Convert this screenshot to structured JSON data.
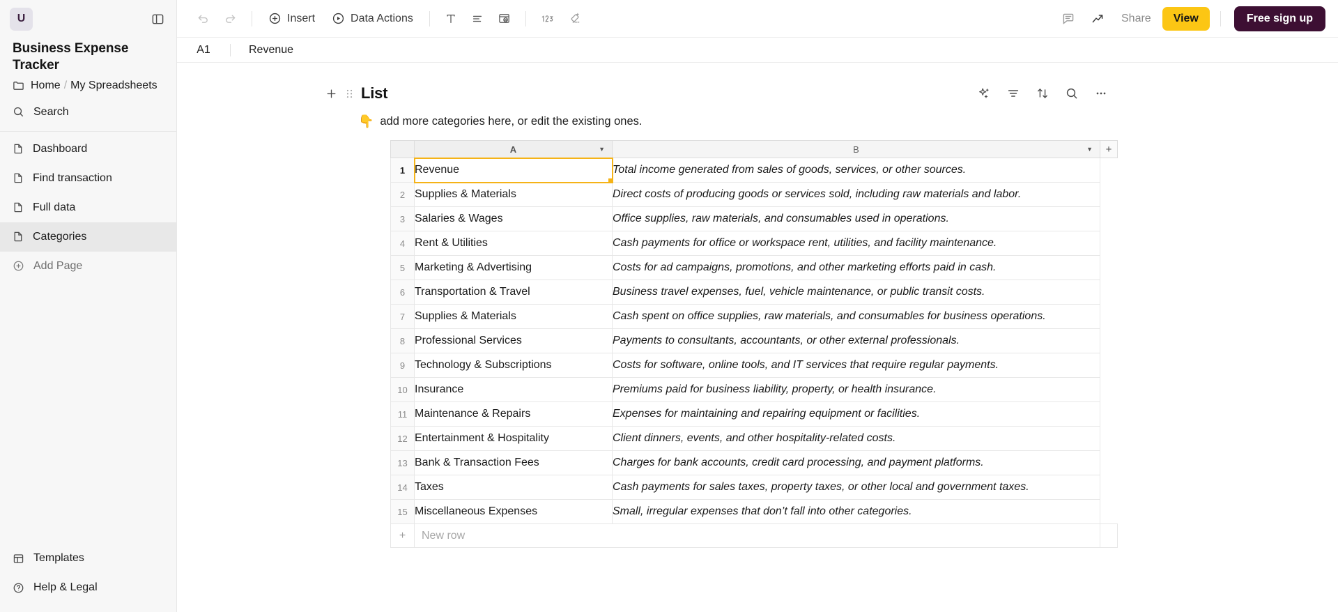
{
  "sidebar": {
    "avatar_initial": "U",
    "doc_title": "Business Expense Tracker",
    "breadcrumb": {
      "home": "Home",
      "separator": "/",
      "folder": "My Spreadsheets"
    },
    "search_label": "Search",
    "pages": [
      {
        "label": "Dashboard",
        "selected": false
      },
      {
        "label": "Find transaction",
        "selected": false
      },
      {
        "label": "Full data",
        "selected": false
      },
      {
        "label": "Categories",
        "selected": true
      }
    ],
    "add_page_label": "Add Page",
    "footer": [
      {
        "label": "Templates"
      },
      {
        "label": "Help & Legal"
      }
    ]
  },
  "toolbar": {
    "undo_label": "Undo",
    "redo_label": "Redo",
    "insert_label": "Insert",
    "data_actions_label": "Data Actions",
    "text_label": "Text",
    "align_label": "Align",
    "fill_label": "Fill color",
    "number_format_label": "123",
    "clear_format_label": "Clear formatting",
    "comment_label": "Comments",
    "insights_label": "Insights",
    "share_label": "Share",
    "view_label": "View",
    "signup_label": "Free sign up"
  },
  "formula_bar": {
    "cell_ref": "A1",
    "value": "Revenue"
  },
  "block": {
    "title": "List",
    "hint_emoji": "👇",
    "hint_text": "add more categories here, or edit the existing ones."
  },
  "grid": {
    "columns": [
      "A",
      "B"
    ],
    "add_column_label": "+",
    "selected_cell": "A1",
    "new_row_label": "New row",
    "new_row_plus": "+",
    "rows": [
      {
        "n": "1",
        "a": "Revenue",
        "b": "Total income generated from sales of goods, services, or other sources."
      },
      {
        "n": "2",
        "a": "Supplies & Materials",
        "b": "Direct costs of producing goods or services sold, including raw materials and labor."
      },
      {
        "n": "3",
        "a": "Salaries & Wages",
        "b": "Office supplies, raw materials, and consumables used in operations."
      },
      {
        "n": "4",
        "a": "Rent & Utilities",
        "b": "Cash payments for office or workspace rent, utilities, and facility maintenance."
      },
      {
        "n": "5",
        "a": "Marketing & Advertising",
        "b": "Costs for ad campaigns, promotions, and other marketing efforts paid in cash."
      },
      {
        "n": "6",
        "a": "Transportation & Travel",
        "b": "Business travel expenses, fuel, vehicle maintenance, or public transit costs."
      },
      {
        "n": "7",
        "a": "Supplies & Materials",
        "b": "Cash spent on office supplies, raw materials, and consumables for business operations."
      },
      {
        "n": "8",
        "a": "Professional Services",
        "b": "Payments to consultants, accountants, or other external professionals."
      },
      {
        "n": "9",
        "a": "Technology & Subscriptions",
        "b": "Costs for software, online tools, and IT services that require regular payments."
      },
      {
        "n": "10",
        "a": "Insurance",
        "b": "Premiums paid for business liability, property, or health insurance."
      },
      {
        "n": "11",
        "a": "Maintenance & Repairs",
        "b": "Expenses for maintaining and repairing equipment or facilities."
      },
      {
        "n": "12",
        "a": "Entertainment & Hospitality",
        "b": "Client dinners, events, and other hospitality-related costs."
      },
      {
        "n": "13",
        "a": "Bank & Transaction Fees",
        "b": "Charges for bank accounts, credit card processing, and payment platforms."
      },
      {
        "n": "14",
        "a": "Taxes",
        "b": "Cash payments for sales taxes, property taxes, or other local and government taxes."
      },
      {
        "n": "15",
        "a": "Miscellaneous Expenses",
        "b": "Small, irregular expenses that don’t fall into other categories."
      }
    ]
  },
  "colors": {
    "accent_yellow": "#fcc614",
    "signup_purple": "#3d0f33",
    "selection": "#f5b317"
  }
}
